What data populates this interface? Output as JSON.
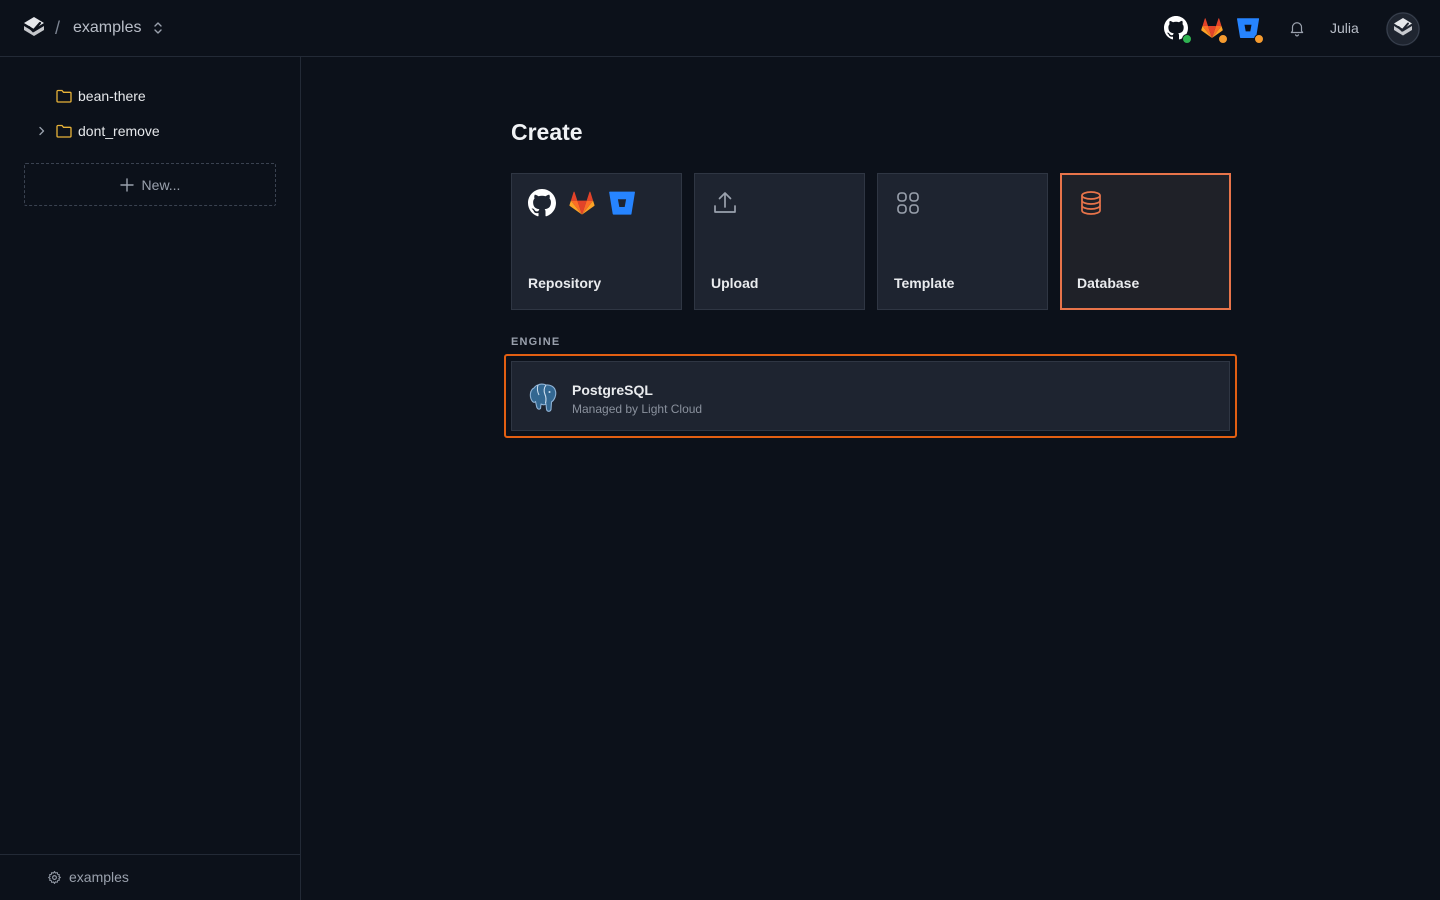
{
  "header": {
    "separator": "/",
    "project": "examples",
    "user": "Julia"
  },
  "sidebar": {
    "items": [
      {
        "label": "bean-there",
        "expandable": false
      },
      {
        "label": "dont_remove",
        "expandable": true
      }
    ],
    "new_label": "New...",
    "footer_label": "examples"
  },
  "main": {
    "title": "Create",
    "cards": [
      {
        "label": "Repository",
        "icon": "git-providers-icon"
      },
      {
        "label": "Upload",
        "icon": "upload-icon"
      },
      {
        "label": "Template",
        "icon": "template-grid-icon"
      },
      {
        "label": "Database",
        "icon": "database-icon",
        "selected": true
      }
    ],
    "engine_section": "ENGINE",
    "engines": [
      {
        "name": "PostgreSQL",
        "subtitle": "Managed by Light Cloud"
      }
    ]
  },
  "colors": {
    "accent": "#e8744a",
    "focus": "#e35f12",
    "github_status": "#2fb351",
    "gitlab_status": "#f59b2f",
    "bitbucket_status": "#f59b2f"
  }
}
